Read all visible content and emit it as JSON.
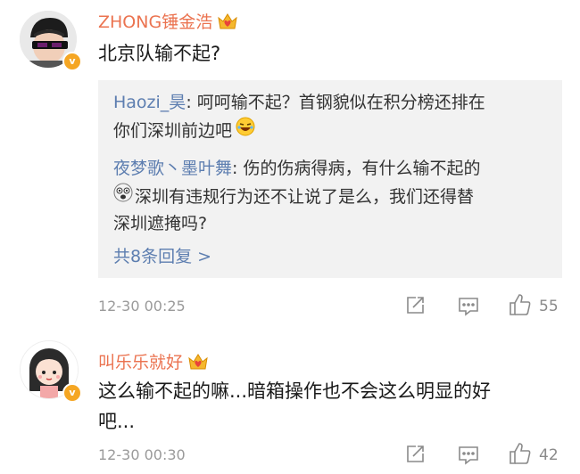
{
  "comments": [
    {
      "username": "ZHONG锤金浩",
      "text": "北京队输不起?",
      "replies": [
        {
          "name": "Haozi_昊",
          "line1": "呵呵输不起？首钢貌似在积分榜还排在",
          "line2": "你们深圳前边吧"
        },
        {
          "name": "夜梦歌丶墨叶舞",
          "line1": "伤的伤病得病，有什么输不起的",
          "line2": "深圳有违规行为还不让说了是么，我们还得替",
          "line3": "深圳遮掩吗?"
        }
      ],
      "more_replies": "共8条回复 >",
      "time": "12-30 00:25",
      "likes": "55"
    },
    {
      "username": "叫乐乐就好",
      "text_line1": "这么输不起的嘛...暗箱操作也不会这么明显的好",
      "text_line2": "吧...",
      "time": "12-30 00:30",
      "likes": "42"
    }
  ],
  "icons": {
    "vip": "crown-heart-icon",
    "verified": "verified-v-icon",
    "share": "share-icon",
    "comment": "comment-icon",
    "like": "thumbs-up-icon",
    "emoji1": "laugh-emoji-icon",
    "emoji2": "dizzy-emoji-icon"
  },
  "colors": {
    "username": "#eb7350",
    "link": "#5d7eb0",
    "meta": "#9a9a9a",
    "reply_bg": "#f2f2f2"
  }
}
